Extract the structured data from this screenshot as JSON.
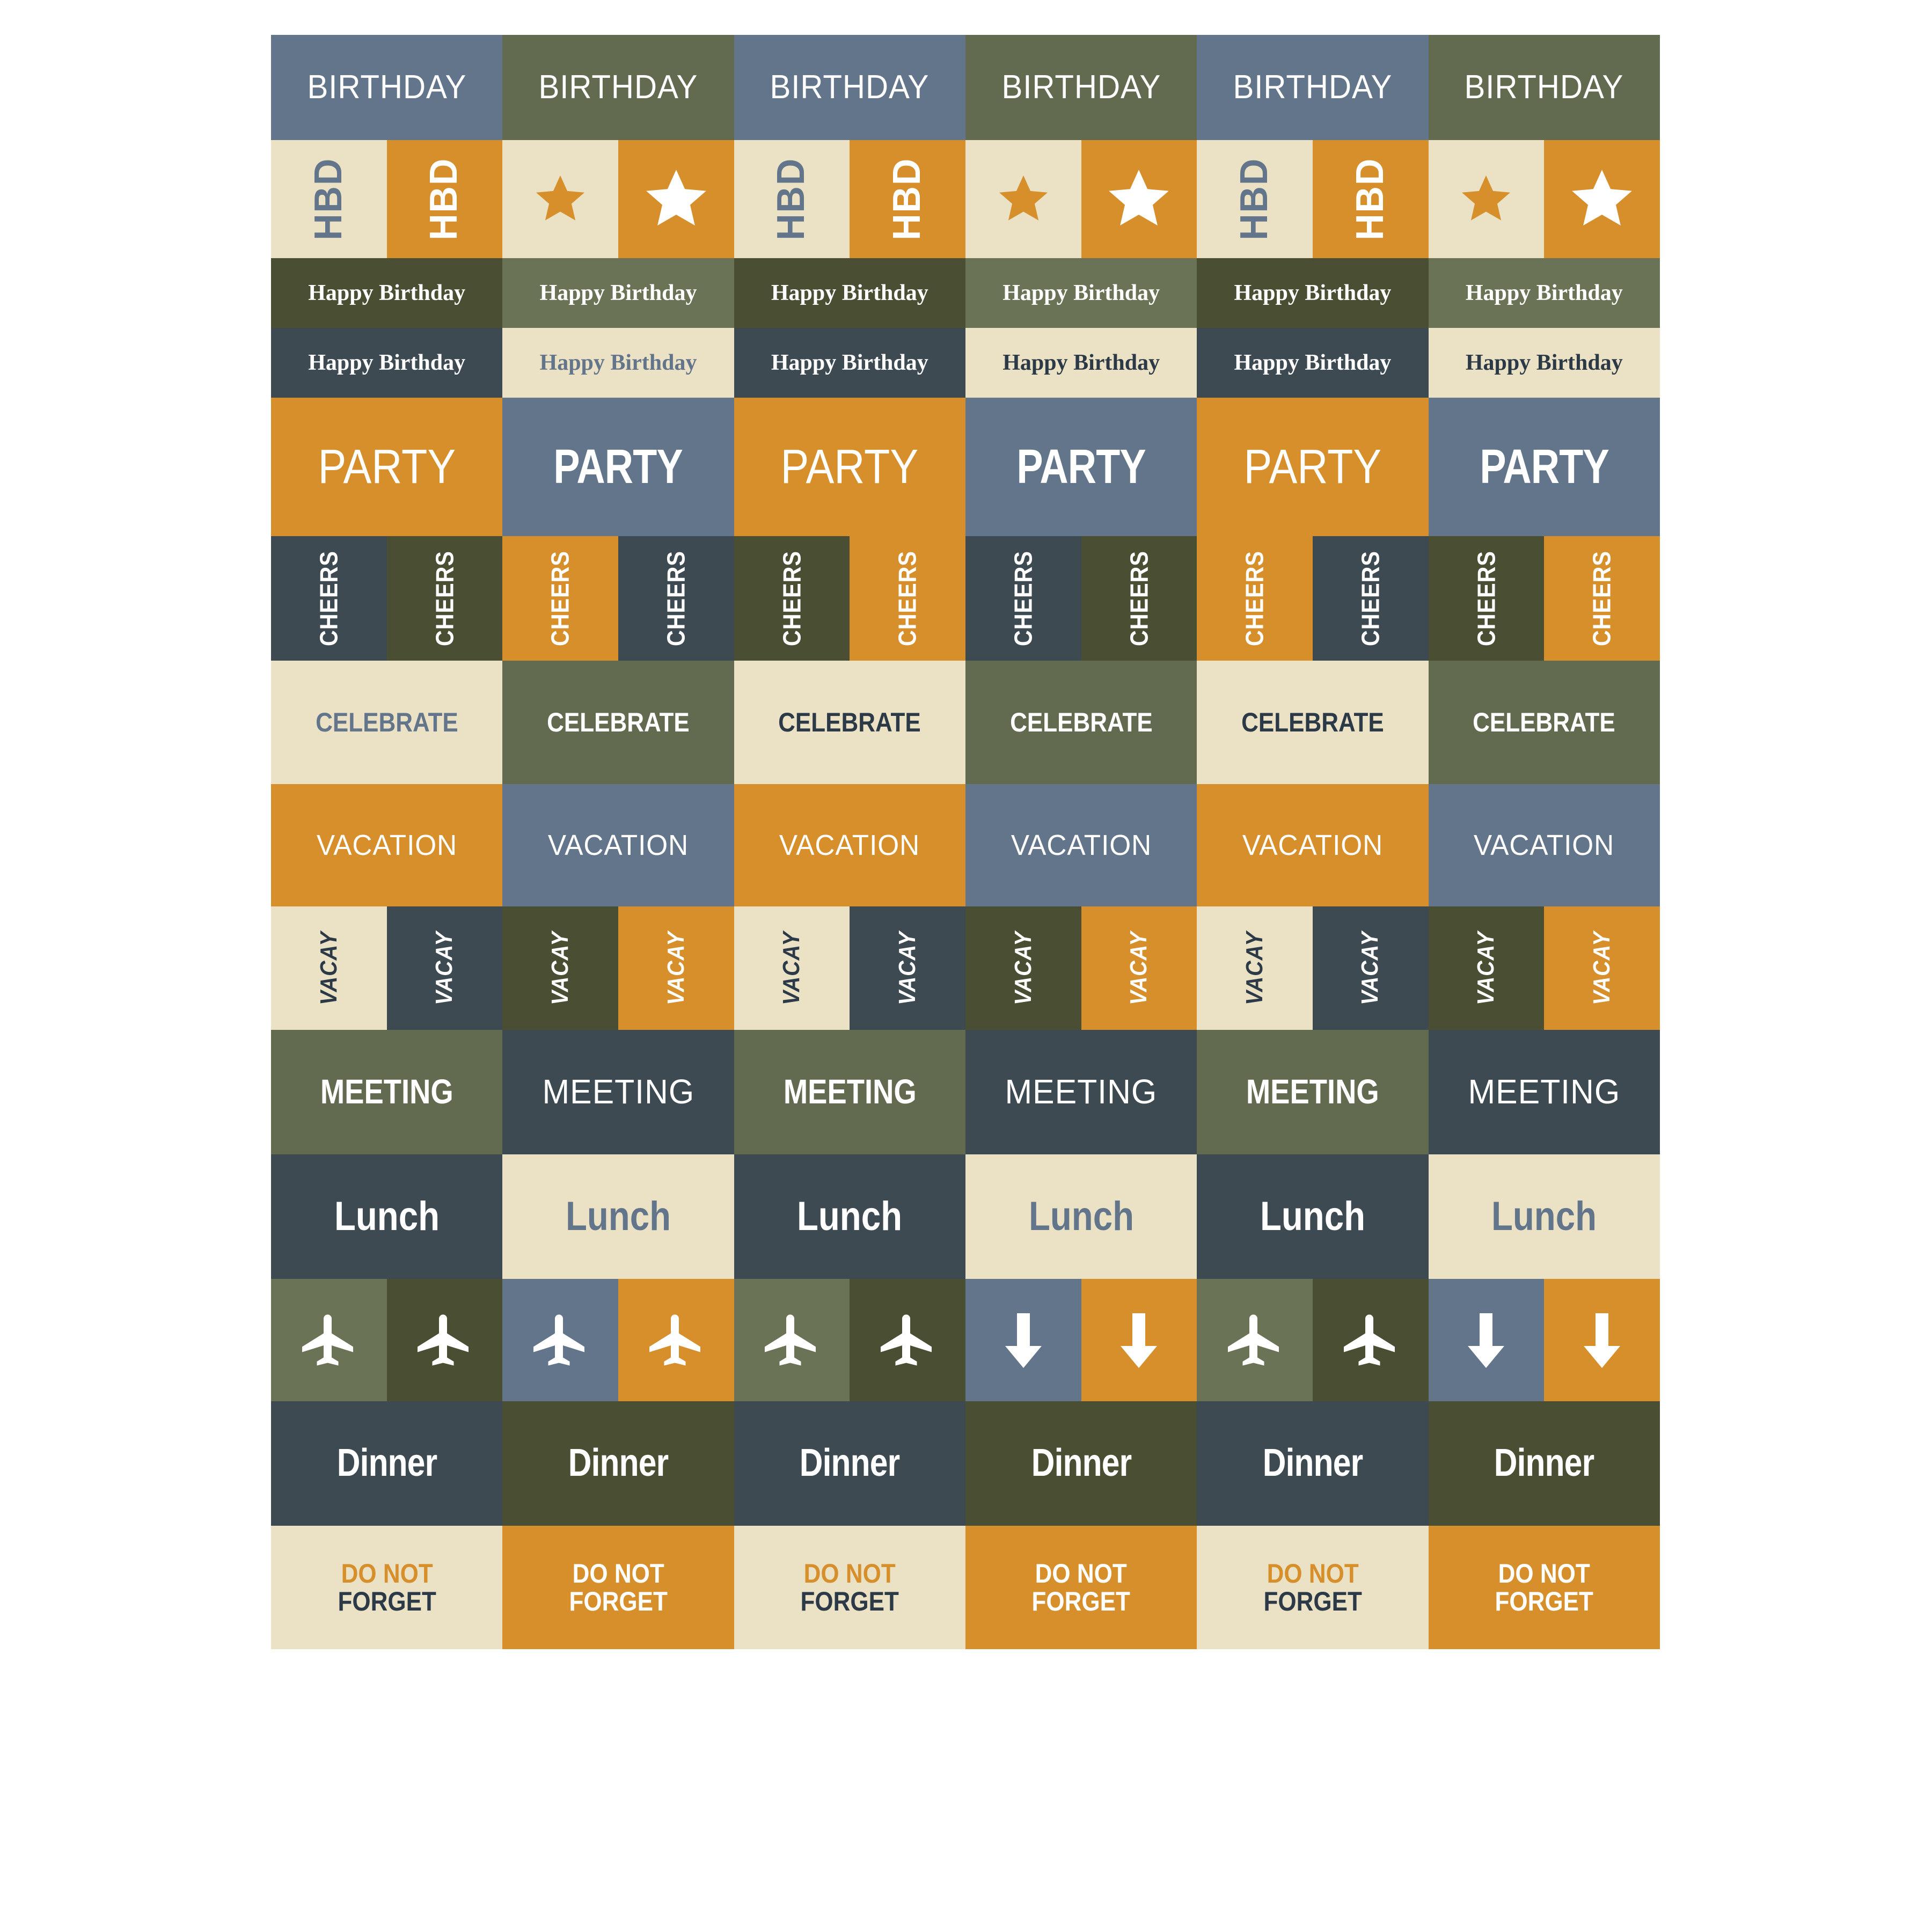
{
  "palette": {
    "slate_blue": "#63758A",
    "olive": "#626B50",
    "olive_light": "#6A7355",
    "olive_dark": "#4A4E33",
    "orange": "#D68F2A",
    "cream": "#EBE1C4",
    "dark_slate": "#3D4A52",
    "white": "#FFFFFF",
    "navy_text": "#2C3A47"
  },
  "sheet": {
    "columns": 6,
    "rows": [
      {
        "name": "birthday-row",
        "cells": [
          {
            "label": "BIRTHDAY",
            "bg": "#63758A",
            "fg": "#FFFFFF",
            "style": "thin"
          },
          {
            "label": "BIRTHDAY",
            "bg": "#626B50",
            "fg": "#FFFFFF",
            "style": "thin"
          },
          {
            "label": "BIRTHDAY",
            "bg": "#63758A",
            "fg": "#FFFFFF",
            "style": "thin"
          },
          {
            "label": "BIRTHDAY",
            "bg": "#626B50",
            "fg": "#FFFFFF",
            "style": "thin"
          },
          {
            "label": "BIRTHDAY",
            "bg": "#63758A",
            "fg": "#FFFFFF",
            "style": "thin"
          },
          {
            "label": "BIRTHDAY",
            "bg": "#626B50",
            "fg": "#FFFFFF",
            "style": "thin"
          }
        ]
      },
      {
        "name": "hbd-row",
        "cells": [
          {
            "label": "HBD",
            "bg": "#EBE1C4",
            "fg": "#63758A",
            "kind": "text"
          },
          {
            "label": "HBD",
            "bg": "#D68F2A",
            "fg": "#FFFFFF",
            "kind": "text"
          },
          {
            "label": "",
            "bg": "#EBE1C4",
            "fg": "#D68F2A",
            "kind": "star"
          },
          {
            "label": "",
            "bg": "#D68F2A",
            "fg": "#FFFFFF",
            "kind": "star"
          },
          {
            "label": "HBD",
            "bg": "#EBE1C4",
            "fg": "#63758A",
            "kind": "text"
          },
          {
            "label": "HBD",
            "bg": "#D68F2A",
            "fg": "#FFFFFF",
            "kind": "text"
          },
          {
            "label": "",
            "bg": "#EBE1C4",
            "fg": "#D68F2A",
            "kind": "star"
          },
          {
            "label": "",
            "bg": "#D68F2A",
            "fg": "#FFFFFF",
            "kind": "star"
          },
          {
            "label": "HBD",
            "bg": "#EBE1C4",
            "fg": "#63758A",
            "kind": "text"
          },
          {
            "label": "HBD",
            "bg": "#D68F2A",
            "fg": "#FFFFFF",
            "kind": "text"
          },
          {
            "label": "",
            "bg": "#EBE1C4",
            "fg": "#D68F2A",
            "kind": "star"
          },
          {
            "label": "",
            "bg": "#D68F2A",
            "fg": "#FFFFFF",
            "kind": "star"
          }
        ]
      },
      {
        "name": "happy-birthday-row-1",
        "cells": [
          {
            "label": "Happy Birthday",
            "bg": "#4A4E33",
            "fg": "#FFFFFF"
          },
          {
            "label": "Happy Birthday",
            "bg": "#6A7355",
            "fg": "#FFFFFF"
          },
          {
            "label": "Happy Birthday",
            "bg": "#4A4E33",
            "fg": "#FFFFFF"
          },
          {
            "label": "Happy Birthday",
            "bg": "#6A7355",
            "fg": "#FFFFFF"
          },
          {
            "label": "Happy Birthday",
            "bg": "#4A4E33",
            "fg": "#FFFFFF"
          },
          {
            "label": "Happy Birthday",
            "bg": "#6A7355",
            "fg": "#FFFFFF"
          }
        ]
      },
      {
        "name": "happy-birthday-row-2",
        "cells": [
          {
            "label": "Happy Birthday",
            "bg": "#3D4A52",
            "fg": "#FFFFFF"
          },
          {
            "label": "Happy Birthday",
            "bg": "#EBE1C4",
            "fg": "#63758A"
          },
          {
            "label": "Happy Birthday",
            "bg": "#3D4A52",
            "fg": "#FFFFFF"
          },
          {
            "label": "Happy Birthday",
            "bg": "#EBE1C4",
            "fg": "#2C3A47"
          },
          {
            "label": "Happy Birthday",
            "bg": "#3D4A52",
            "fg": "#FFFFFF"
          },
          {
            "label": "Happy Birthday",
            "bg": "#EBE1C4",
            "fg": "#2C3A47"
          }
        ]
      },
      {
        "name": "party-row",
        "cells": [
          {
            "label": "PARTY",
            "bg": "#D68F2A",
            "fg": "#FFFFFF",
            "style": "thin"
          },
          {
            "label": "PARTY",
            "bg": "#63758A",
            "fg": "#FFFFFF",
            "style": "bold"
          },
          {
            "label": "PARTY",
            "bg": "#D68F2A",
            "fg": "#FFFFFF",
            "style": "thin"
          },
          {
            "label": "PARTY",
            "bg": "#63758A",
            "fg": "#FFFFFF",
            "style": "bold"
          },
          {
            "label": "PARTY",
            "bg": "#D68F2A",
            "fg": "#FFFFFF",
            "style": "thin"
          },
          {
            "label": "PARTY",
            "bg": "#63758A",
            "fg": "#FFFFFF",
            "style": "bold"
          }
        ]
      },
      {
        "name": "cheers-row",
        "cells": [
          {
            "label": "CHEERS",
            "bg": "#3D4A52",
            "fg": "#FFFFFF"
          },
          {
            "label": "CHEERS",
            "bg": "#4A4E33",
            "fg": "#FFFFFF"
          },
          {
            "label": "CHEERS",
            "bg": "#D68F2A",
            "fg": "#FFFFFF"
          },
          {
            "label": "CHEERS",
            "bg": "#3D4A52",
            "fg": "#FFFFFF"
          },
          {
            "label": "CHEERS",
            "bg": "#4A4E33",
            "fg": "#FFFFFF"
          },
          {
            "label": "CHEERS",
            "bg": "#D68F2A",
            "fg": "#FFFFFF"
          },
          {
            "label": "CHEERS",
            "bg": "#3D4A52",
            "fg": "#FFFFFF"
          },
          {
            "label": "CHEERS",
            "bg": "#4A4E33",
            "fg": "#FFFFFF"
          },
          {
            "label": "CHEERS",
            "bg": "#D68F2A",
            "fg": "#FFFFFF"
          },
          {
            "label": "CHEERS",
            "bg": "#3D4A52",
            "fg": "#FFFFFF"
          },
          {
            "label": "CHEERS",
            "bg": "#4A4E33",
            "fg": "#FFFFFF"
          },
          {
            "label": "CHEERS",
            "bg": "#D68F2A",
            "fg": "#FFFFFF"
          }
        ]
      },
      {
        "name": "celebrate-row",
        "cells": [
          {
            "label": "CELEBRATE",
            "bg": "#EBE1C4",
            "fg": "#63758A"
          },
          {
            "label": "CELEBRATE",
            "bg": "#626B50",
            "fg": "#FFFFFF"
          },
          {
            "label": "CELEBRATE",
            "bg": "#EBE1C4",
            "fg": "#2C3A47"
          },
          {
            "label": "CELEBRATE",
            "bg": "#626B50",
            "fg": "#FFFFFF"
          },
          {
            "label": "CELEBRATE",
            "bg": "#EBE1C4",
            "fg": "#2C3A47"
          },
          {
            "label": "CELEBRATE",
            "bg": "#626B50",
            "fg": "#FFFFFF"
          }
        ]
      },
      {
        "name": "vacation-row",
        "cells": [
          {
            "label": "VACATION",
            "bg": "#D68F2A",
            "fg": "#FFFFFF"
          },
          {
            "label": "VACATION",
            "bg": "#63758A",
            "fg": "#FFFFFF"
          },
          {
            "label": "VACATION",
            "bg": "#D68F2A",
            "fg": "#FFFFFF"
          },
          {
            "label": "VACATION",
            "bg": "#63758A",
            "fg": "#FFFFFF"
          },
          {
            "label": "VACATION",
            "bg": "#D68F2A",
            "fg": "#FFFFFF"
          },
          {
            "label": "VACATION",
            "bg": "#63758A",
            "fg": "#FFFFFF"
          }
        ]
      },
      {
        "name": "vacay-row",
        "cells": [
          {
            "label": "VACAY",
            "bg": "#EBE1C4",
            "fg": "#2C3A47"
          },
          {
            "label": "VACAY",
            "bg": "#3D4A52",
            "fg": "#FFFFFF"
          },
          {
            "label": "VACAY",
            "bg": "#4A4E33",
            "fg": "#FFFFFF"
          },
          {
            "label": "VACAY",
            "bg": "#D68F2A",
            "fg": "#FFFFFF"
          },
          {
            "label": "VACAY",
            "bg": "#EBE1C4",
            "fg": "#2C3A47"
          },
          {
            "label": "VACAY",
            "bg": "#3D4A52",
            "fg": "#FFFFFF"
          },
          {
            "label": "VACAY",
            "bg": "#4A4E33",
            "fg": "#FFFFFF"
          },
          {
            "label": "VACAY",
            "bg": "#D68F2A",
            "fg": "#FFFFFF"
          },
          {
            "label": "VACAY",
            "bg": "#EBE1C4",
            "fg": "#2C3A47"
          },
          {
            "label": "VACAY",
            "bg": "#3D4A52",
            "fg": "#FFFFFF"
          },
          {
            "label": "VACAY",
            "bg": "#4A4E33",
            "fg": "#FFFFFF"
          },
          {
            "label": "VACAY",
            "bg": "#D68F2A",
            "fg": "#FFFFFF"
          }
        ]
      },
      {
        "name": "meeting-row",
        "cells": [
          {
            "label": "MEETING",
            "bg": "#626B50",
            "fg": "#FFFFFF",
            "style": "bold"
          },
          {
            "label": "MEETING",
            "bg": "#3D4A52",
            "fg": "#FFFFFF",
            "style": "thin"
          },
          {
            "label": "MEETING",
            "bg": "#626B50",
            "fg": "#FFFFFF",
            "style": "bold"
          },
          {
            "label": "MEETING",
            "bg": "#3D4A52",
            "fg": "#FFFFFF",
            "style": "thin"
          },
          {
            "label": "MEETING",
            "bg": "#626B50",
            "fg": "#FFFFFF",
            "style": "bold"
          },
          {
            "label": "MEETING",
            "bg": "#3D4A52",
            "fg": "#FFFFFF",
            "style": "thin"
          }
        ]
      },
      {
        "name": "lunch-row",
        "cells": [
          {
            "label": "Lunch",
            "bg": "#3D4A52",
            "fg": "#FFFFFF"
          },
          {
            "label": "Lunch",
            "bg": "#EBE1C4",
            "fg": "#63758A"
          },
          {
            "label": "Lunch",
            "bg": "#3D4A52",
            "fg": "#FFFFFF"
          },
          {
            "label": "Lunch",
            "bg": "#EBE1C4",
            "fg": "#63758A"
          },
          {
            "label": "Lunch",
            "bg": "#3D4A52",
            "fg": "#FFFFFF"
          },
          {
            "label": "Lunch",
            "bg": "#EBE1C4",
            "fg": "#63758A"
          }
        ]
      },
      {
        "name": "travel-icon-row",
        "cells": [
          {
            "icon": "airplane-icon",
            "bg": "#6A7355",
            "fg": "#FFFFFF"
          },
          {
            "icon": "airplane-icon",
            "bg": "#4A4E33",
            "fg": "#FFFFFF"
          },
          {
            "icon": "airplane-icon",
            "bg": "#63758A",
            "fg": "#FFFFFF"
          },
          {
            "icon": "airplane-icon",
            "bg": "#D68F2A",
            "fg": "#FFFFFF"
          },
          {
            "icon": "airplane-icon",
            "bg": "#6A7355",
            "fg": "#FFFFFF"
          },
          {
            "icon": "airplane-icon",
            "bg": "#4A4E33",
            "fg": "#FFFFFF"
          },
          {
            "icon": "down-arrow-icon",
            "bg": "#63758A",
            "fg": "#FFFFFF"
          },
          {
            "icon": "down-arrow-icon",
            "bg": "#D68F2A",
            "fg": "#FFFFFF"
          },
          {
            "icon": "airplane-icon",
            "bg": "#6A7355",
            "fg": "#FFFFFF"
          },
          {
            "icon": "airplane-icon",
            "bg": "#4A4E33",
            "fg": "#FFFFFF"
          },
          {
            "icon": "down-arrow-icon",
            "bg": "#63758A",
            "fg": "#FFFFFF"
          },
          {
            "icon": "down-arrow-icon",
            "bg": "#D68F2A",
            "fg": "#FFFFFF"
          }
        ]
      },
      {
        "name": "dinner-row",
        "cells": [
          {
            "label": "Dinner",
            "bg": "#3D4A52",
            "fg": "#FFFFFF"
          },
          {
            "label": "Dinner",
            "bg": "#4A4E33",
            "fg": "#FFFFFF"
          },
          {
            "label": "Dinner",
            "bg": "#3D4A52",
            "fg": "#FFFFFF"
          },
          {
            "label": "Dinner",
            "bg": "#4A4E33",
            "fg": "#FFFFFF"
          },
          {
            "label": "Dinner",
            "bg": "#3D4A52",
            "fg": "#FFFFFF"
          },
          {
            "label": "Dinner",
            "bg": "#4A4E33",
            "fg": "#FFFFFF"
          }
        ]
      },
      {
        "name": "do-not-forget-row",
        "cells": [
          {
            "line1": "DO NOT",
            "line2": "FORGET",
            "bg": "#EBE1C4",
            "fg1": "#D68F2A",
            "fg2": "#2C3A47"
          },
          {
            "line1": "DO NOT",
            "line2": "FORGET",
            "bg": "#D68F2A",
            "fg1": "#FFFFFF",
            "fg2": "#FFFFFF"
          },
          {
            "line1": "DO NOT",
            "line2": "FORGET",
            "bg": "#EBE1C4",
            "fg1": "#D68F2A",
            "fg2": "#2C3A47"
          },
          {
            "line1": "DO NOT",
            "line2": "FORGET",
            "bg": "#D68F2A",
            "fg1": "#FFFFFF",
            "fg2": "#FFFFFF"
          },
          {
            "line1": "DO NOT",
            "line2": "FORGET",
            "bg": "#EBE1C4",
            "fg1": "#D68F2A",
            "fg2": "#2C3A47"
          },
          {
            "line1": "DO NOT",
            "line2": "FORGET",
            "bg": "#D68F2A",
            "fg1": "#FFFFFF",
            "fg2": "#FFFFFF"
          }
        ]
      }
    ],
    "labels": {
      "birthday": "BIRTHDAY",
      "hbd": "HBD",
      "happy_birthday": "Happy Birthday",
      "party": "PARTY",
      "cheers": "CHEERS",
      "celebrate": "CELEBRATE",
      "vacation": "VACATION",
      "vacay": "VACAY",
      "meeting": "MEETING",
      "lunch": "Lunch",
      "dinner": "Dinner",
      "do_not": "DO NOT",
      "forget": "FORGET"
    },
    "icons": {
      "star": "star-icon",
      "airplane": "airplane-icon",
      "down_arrow": "down-arrow-icon"
    }
  }
}
